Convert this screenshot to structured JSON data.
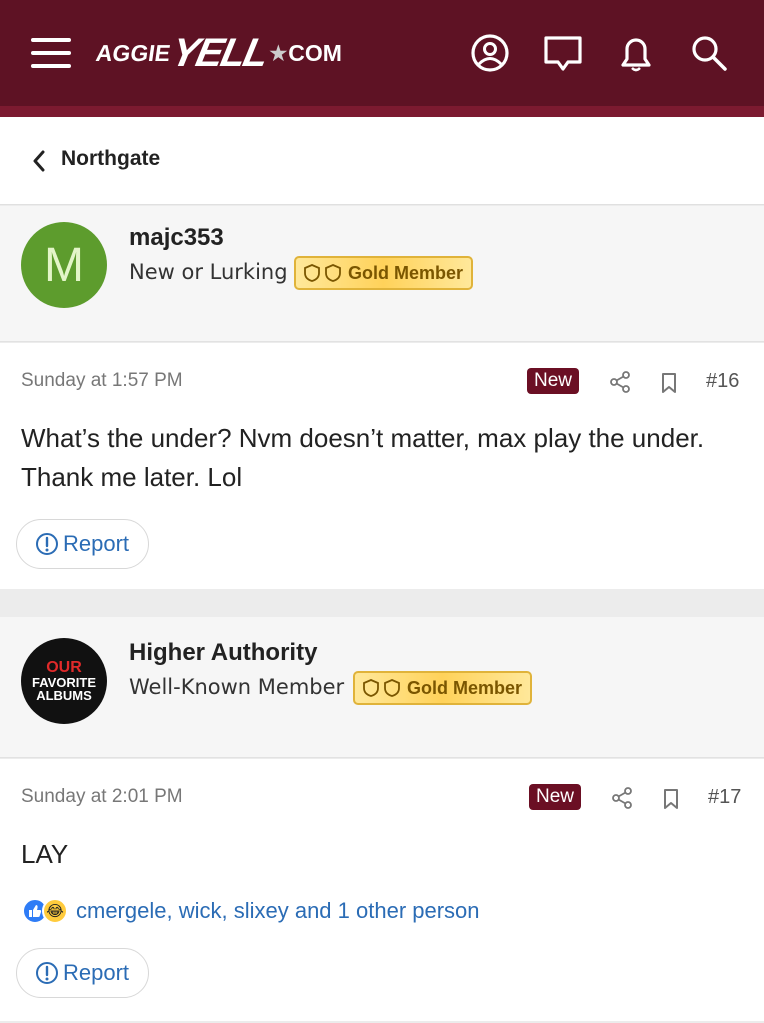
{
  "header": {
    "logo_left": "AGGIE",
    "logo_mid": "YELL",
    "logo_right": "COM",
    "icons": [
      "menu-icon",
      "account-icon",
      "messages-icon",
      "alerts-icon",
      "search-icon"
    ],
    "bg_color": "#5e1224"
  },
  "breadcrumb": {
    "label": "Northgate"
  },
  "posts": [
    {
      "avatar_letter": "M",
      "username": "majc353",
      "user_title": "New or Lurking",
      "badge": "Gold Member",
      "time": "Sunday at 1:57 PM",
      "new_label": "New",
      "number": "#16",
      "body": "What’s the under? Nvm doesn’t matter, max play the under. Thank me later. Lol",
      "report": "Report"
    },
    {
      "avatar_text": [
        "OUR",
        "FAVORITE",
        "ALBUMS"
      ],
      "username": "Higher Authority",
      "user_title": "Well-Known Member",
      "badge": "Gold Member",
      "time": "Sunday at 2:01 PM",
      "new_label": "New",
      "number": "#17",
      "body": "LAY",
      "reactions": "cmergele, wick, slixey and 1 other person",
      "report": "Report"
    }
  ],
  "colors": {
    "accent": "#6b0f24",
    "link": "#2b6cb5",
    "gold": "#ffd25a"
  }
}
